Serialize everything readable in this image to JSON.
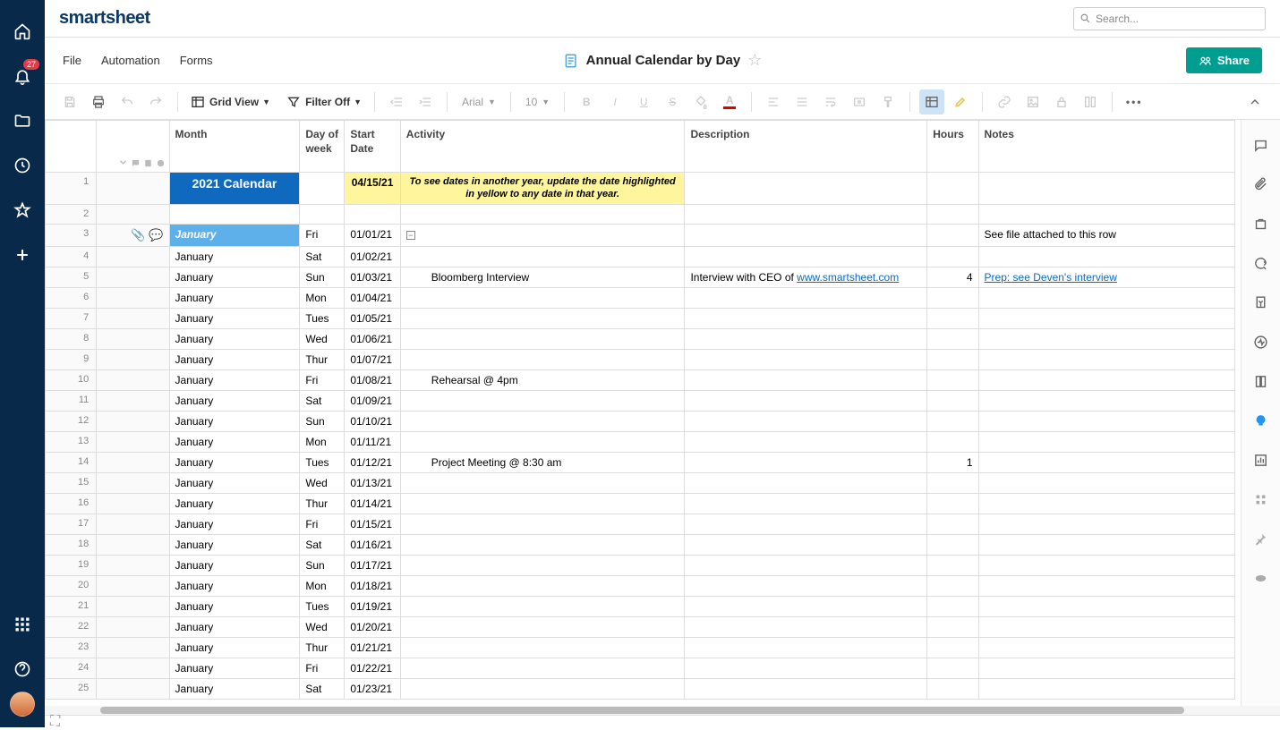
{
  "logo": "smartsheet",
  "search_placeholder": "Search...",
  "notification_badge": "27",
  "menu": {
    "file": "File",
    "automation": "Automation",
    "forms": "Forms"
  },
  "sheet_title": "Annual Calendar by Day",
  "share_label": "Share",
  "toolbar": {
    "view_label": "Grid View",
    "filter_label": "Filter Off",
    "font_name": "Arial",
    "font_size": "10"
  },
  "columns": {
    "month": "Month",
    "dow": "Day of week",
    "start_date": "Start Date",
    "activity": "Activity",
    "description": "Description",
    "hours": "Hours",
    "notes": "Notes"
  },
  "row1": {
    "month": "2021 Calendar",
    "date": "04/15/21",
    "activity": "To see dates in another year, update the date highlighted in yellow to any date in that year."
  },
  "row3": {
    "month": "January",
    "dow": "Fri",
    "date": "01/01/21",
    "notes": "See file attached to this row"
  },
  "rows": [
    {
      "n": 4,
      "month": "January",
      "dow": "Sat",
      "date": "01/02/21"
    },
    {
      "n": 5,
      "month": "January",
      "dow": "Sun",
      "date": "01/03/21",
      "activity": "Bloomberg Interview",
      "desc_prefix": "Interview with CEO of ",
      "desc_link": "www.smartsheet.com",
      "hours": "4",
      "notes_link": "Prep: see Deven's interview"
    },
    {
      "n": 6,
      "month": "January",
      "dow": "Mon",
      "date": "01/04/21"
    },
    {
      "n": 7,
      "month": "January",
      "dow": "Tues",
      "date": "01/05/21"
    },
    {
      "n": 8,
      "month": "January",
      "dow": "Wed",
      "date": "01/06/21"
    },
    {
      "n": 9,
      "month": "January",
      "dow": "Thur",
      "date": "01/07/21"
    },
    {
      "n": 10,
      "month": "January",
      "dow": "Fri",
      "date": "01/08/21",
      "activity": "Rehearsal @ 4pm"
    },
    {
      "n": 11,
      "month": "January",
      "dow": "Sat",
      "date": "01/09/21"
    },
    {
      "n": 12,
      "month": "January",
      "dow": "Sun",
      "date": "01/10/21"
    },
    {
      "n": 13,
      "month": "January",
      "dow": "Mon",
      "date": "01/11/21"
    },
    {
      "n": 14,
      "month": "January",
      "dow": "Tues",
      "date": "01/12/21",
      "activity": "Project Meeting @ 8:30 am",
      "hours": "1"
    },
    {
      "n": 15,
      "month": "January",
      "dow": "Wed",
      "date": "01/13/21"
    },
    {
      "n": 16,
      "month": "January",
      "dow": "Thur",
      "date": "01/14/21"
    },
    {
      "n": 17,
      "month": "January",
      "dow": "Fri",
      "date": "01/15/21"
    },
    {
      "n": 18,
      "month": "January",
      "dow": "Sat",
      "date": "01/16/21"
    },
    {
      "n": 19,
      "month": "January",
      "dow": "Sun",
      "date": "01/17/21"
    },
    {
      "n": 20,
      "month": "January",
      "dow": "Mon",
      "date": "01/18/21"
    },
    {
      "n": 21,
      "month": "January",
      "dow": "Tues",
      "date": "01/19/21"
    },
    {
      "n": 22,
      "month": "January",
      "dow": "Wed",
      "date": "01/20/21"
    },
    {
      "n": 23,
      "month": "January",
      "dow": "Thur",
      "date": "01/21/21"
    },
    {
      "n": 24,
      "month": "January",
      "dow": "Fri",
      "date": "01/22/21"
    },
    {
      "n": 25,
      "month": "January",
      "dow": "Sat",
      "date": "01/23/21"
    }
  ]
}
